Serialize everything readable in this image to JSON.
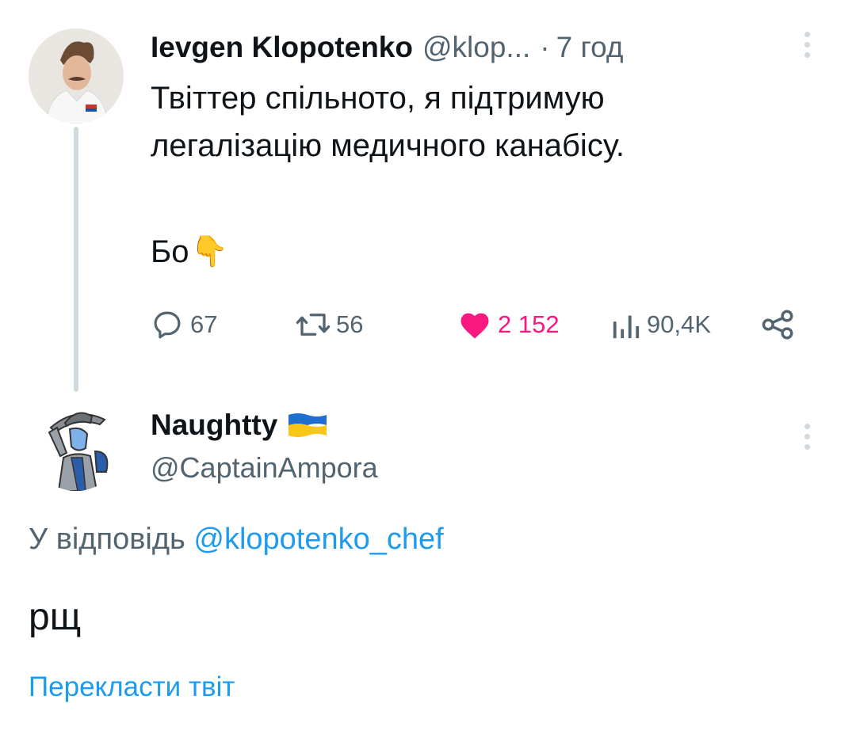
{
  "tweet": {
    "author_name": "Ievgen Klopotenko",
    "handle": "@klop...",
    "separator": "·",
    "time": "7 год",
    "text_line1": "Твіттер спільното, я підтримую",
    "text_line2": "легалізацію медичного канабісу.",
    "text_line3": "Бо",
    "emoji": "👇",
    "avatar_icon": "chef-avatar",
    "stats": {
      "replies": "67",
      "retweets": "56",
      "likes": "2 152",
      "views": "90,4K"
    },
    "like_color": "#f91880"
  },
  "reply": {
    "author_name": "Naughtty",
    "flag_icon": "ukraine-flag-icon",
    "handle": "@CaptainAmpora",
    "reply_to_prefix": "У відповідь",
    "reply_to_handle": "@klopotenko_chef",
    "text": "рщ",
    "translate_label": "Перекласти твіт",
    "avatar_icon": "cartoon-cowboy-avatar"
  }
}
